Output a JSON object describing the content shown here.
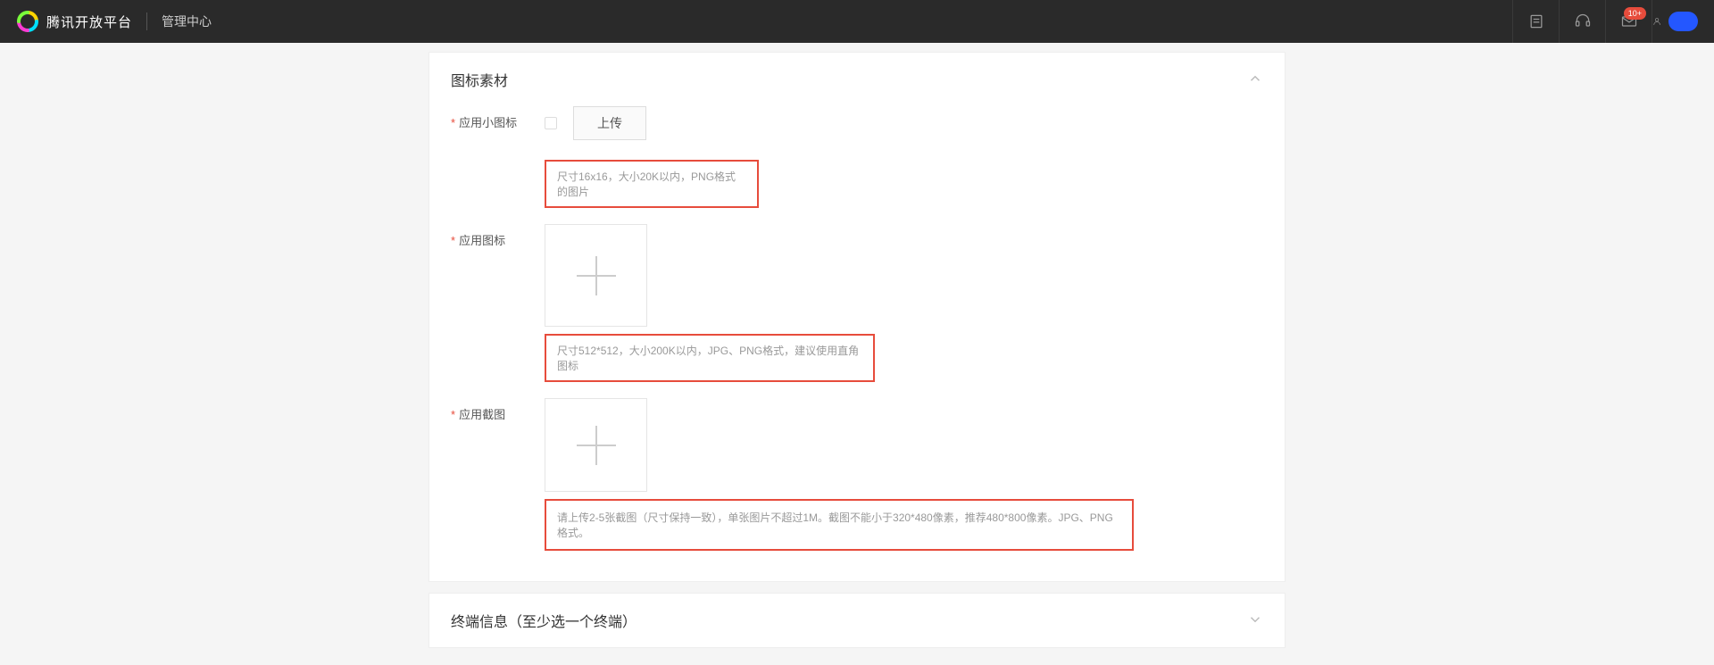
{
  "header": {
    "brand": "腾讯开放平台",
    "subtitle": "管理中心",
    "notification_count": "10+"
  },
  "panel1": {
    "title": "图标素材",
    "rows": {
      "small_icon": {
        "label": "应用小图标",
        "upload_btn": "上传",
        "hint": "尺寸16x16，大小20K以内，PNG格式的图片"
      },
      "app_icon": {
        "label": "应用图标",
        "hint": "尺寸512*512，大小200K以内，JPG、PNG格式，建议使用直角图标"
      },
      "screenshot": {
        "label": "应用截图",
        "hint": "请上传2-5张截图（尺寸保持一致），单张图片不超过1M。截图不能小于320*480像素，推荐480*800像素。JPG、PNG格式。"
      }
    }
  },
  "panel2": {
    "title": "终端信息（至少选一个终端）"
  }
}
